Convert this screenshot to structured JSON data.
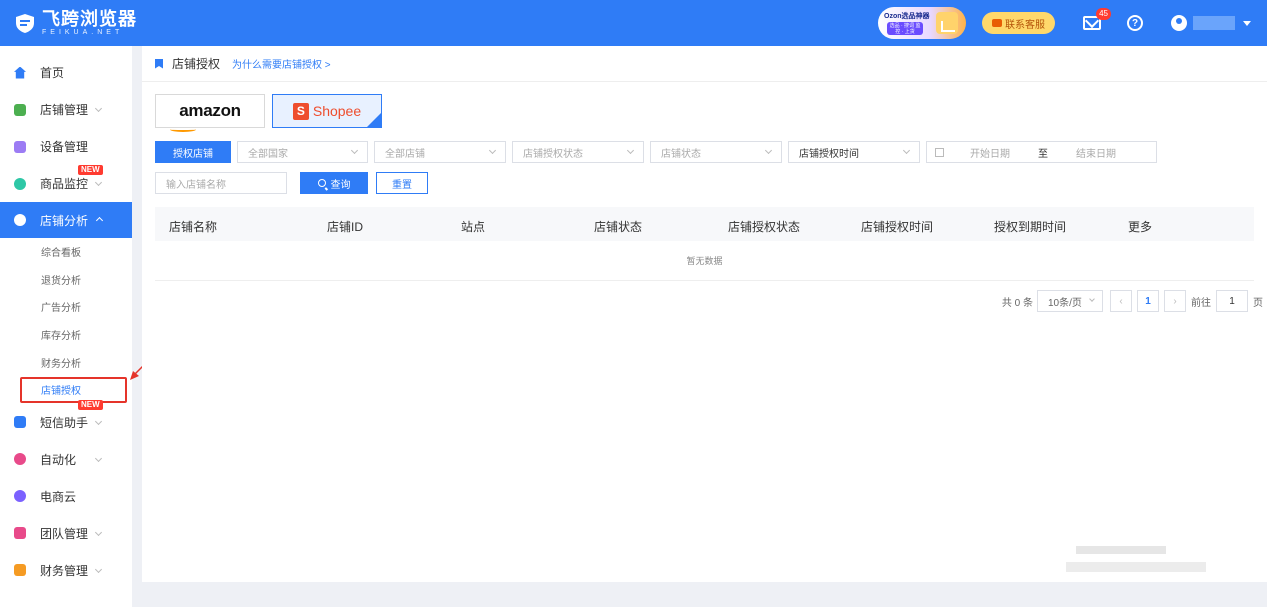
{
  "app": {
    "name_cn": "飞跨浏览器",
    "name_en": "FEIKUA.NET"
  },
  "topbar": {
    "ozon_title": "Ozon选品神器",
    "ozon_sub": "选品 · 搜词 监控 · 上货",
    "contact_label": "联系客服",
    "mail_count": "45"
  },
  "sidebar": {
    "items": [
      {
        "label": "首页",
        "icon": "home-icon",
        "color": "#2f7cf6"
      },
      {
        "label": "店铺管理",
        "icon": "store-icon",
        "color": "#4caf50"
      },
      {
        "label": "设备管理",
        "icon": "device-icon",
        "color": "#9c7cf4"
      },
      {
        "label": "商品监控",
        "icon": "monitor-icon",
        "color": "#2ec7a6",
        "badge": "NEW"
      },
      {
        "label": "店铺分析",
        "icon": "analysis-icon",
        "color": "#2f7cf6"
      },
      {
        "label": "短信助手",
        "icon": "sms-icon",
        "color": "#2f7cf6",
        "badge": "NEW"
      },
      {
        "label": "自动化",
        "icon": "robot-icon",
        "color": "#e84a8a"
      },
      {
        "label": "电商云",
        "icon": "cloud-icon",
        "color": "#7b61ff"
      },
      {
        "label": "团队管理",
        "icon": "team-icon",
        "color": "#e84a8a"
      },
      {
        "label": "财务管理",
        "icon": "wallet-icon",
        "color": "#f59b23"
      }
    ],
    "sub_items": [
      "综合看板",
      "退货分析",
      "广告分析",
      "库存分析",
      "财务分析",
      "店铺授权"
    ]
  },
  "header": {
    "title": "店铺授权",
    "help_link": "为什么需要店铺授权 >"
  },
  "platforms": {
    "amazon": "amazon",
    "shopee": "Shopee"
  },
  "filters": {
    "authorize_btn": "授权店铺",
    "country": "全部国家",
    "store": "全部店铺",
    "auth_status": "店铺授权状态",
    "store_status": "店铺状态",
    "auth_time": "店铺授权时间",
    "start_date": "开始日期",
    "to": "至",
    "end_date": "结束日期",
    "search_placeholder": "输入店铺名称",
    "search_btn": "查询",
    "reset_btn": "重置"
  },
  "table": {
    "columns": [
      "店铺名称",
      "店铺ID",
      "站点",
      "店铺状态",
      "店铺授权状态",
      "店铺授权时间",
      "授权到期时间",
      "更多"
    ],
    "empty": "暂无数据"
  },
  "pagination": {
    "total": "共 0 条",
    "page_size": "10条/页",
    "current_page": "1",
    "goto_label": "前往",
    "goto_value": "1",
    "page_suffix": "页"
  }
}
